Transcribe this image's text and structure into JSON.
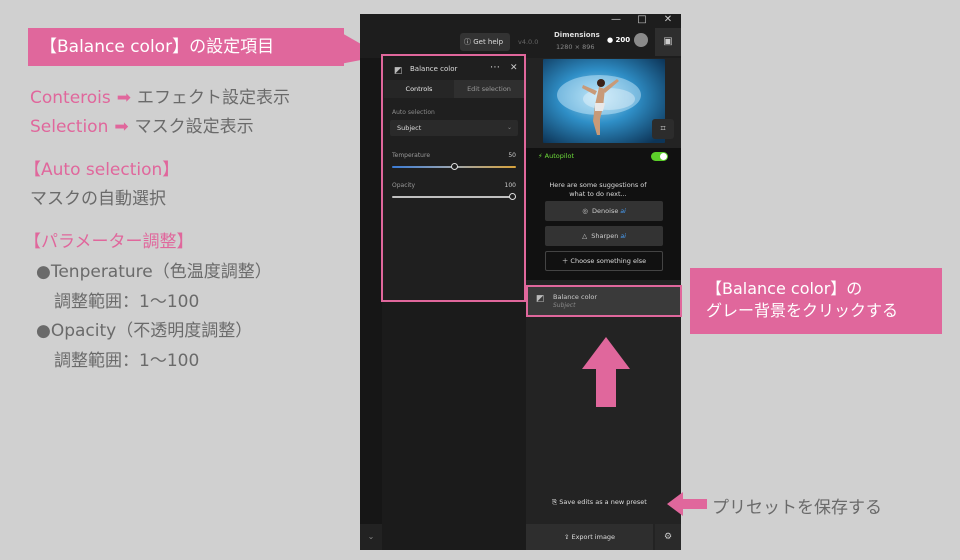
{
  "annotations": {
    "title_label": "【Balance color】の設定項目",
    "line1_a": "Conterois",
    "line1_b": "エフェクト設定表示",
    "line2_a": "Selection",
    "line2_b": "マスク設定表示",
    "auto_sel_heading": "【Auto selection】",
    "auto_sel_desc": "マスクの自動選択",
    "param_heading": "【パラメーター調整】",
    "temp_line": "●Tenperature（色温度調整）",
    "temp_range": "調整範囲：1〜100",
    "opacity_line": "●Opacity（不透明度調整）",
    "opacity_range": "調整範囲：1〜100",
    "callout_line1": "【Balance color】の",
    "callout_line2": "グレー背景をクリックする",
    "preset_note": "プリセットを保存する"
  },
  "app": {
    "get_help": "Get help",
    "version": "v4.0.0",
    "dimensions_title": "Dimensions",
    "dimensions_value": "1280 × 896",
    "credits": "200",
    "panel": {
      "title": "Balance color",
      "tab_controls": "Controls",
      "tab_edit": "Edit selection",
      "auto_selection_label": "Auto selection",
      "auto_selection_value": "Subject",
      "temperature_label": "Temperature",
      "temperature_value": "50",
      "opacity_label": "Opacity",
      "opacity_value": "100"
    },
    "autopilot_label": "Autopilot",
    "suggestions_text": "Here are some suggestions of what to do next...",
    "denoise": "Denoise",
    "sharpen": "Sharpen",
    "ai_badge": "ai",
    "choose_else": "Choose something else",
    "layer_title": "Balance color",
    "layer_sub": "Subject",
    "save_preset": "Save edits as a new preset",
    "export": "Export image"
  },
  "colors": {
    "accent_pink": "#e0679c",
    "autopilot_green": "#5ccf2a",
    "ai_blue": "#4aa3ff"
  },
  "sliders": {
    "temperature_fraction": 0.5,
    "opacity_fraction": 1.0
  }
}
